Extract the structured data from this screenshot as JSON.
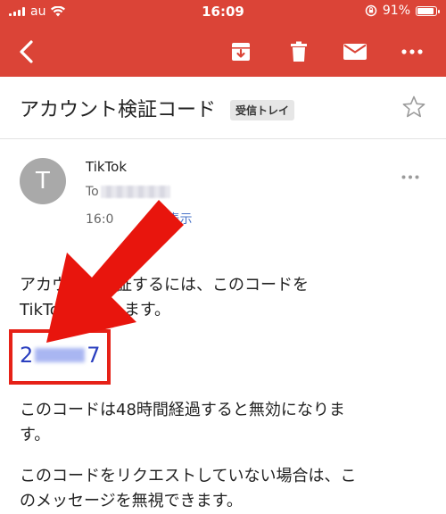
{
  "status_bar": {
    "carrier": "au",
    "time": "16:09",
    "battery": "91%"
  },
  "toolbar": {
    "back_icon": "back-arrow-icon",
    "archive_icon": "archive-icon",
    "delete_icon": "trash-icon",
    "mark_unread_icon": "mail-icon",
    "more_icon": "more-horizontal-icon"
  },
  "email": {
    "subject": "アカウント検証コード",
    "label": "受信トレイ",
    "sender_initial": "T",
    "sender_name": "TikTok",
    "to_prefix": "To",
    "date_prefix": "16:0",
    "details_link": "を表示",
    "body": {
      "p1_line1": "アカウ　　検証するには、このコードを",
      "p1_line2": "TikTo　　力します。",
      "code_first": "2",
      "code_last": "7",
      "p2_line1": "このコードは48時間経過すると無効になりま",
      "p2_line2": "す。",
      "p3_line1": "このコードをリクエストしていない場合は、こ",
      "p3_line2": "のメッセージを無視できます。"
    }
  },
  "colors": {
    "app_bar": "#db4437",
    "highlight_box": "#e62117",
    "arrow": "#e8150d",
    "link": "#4a74c9",
    "code_text": "#2a3fbf"
  }
}
